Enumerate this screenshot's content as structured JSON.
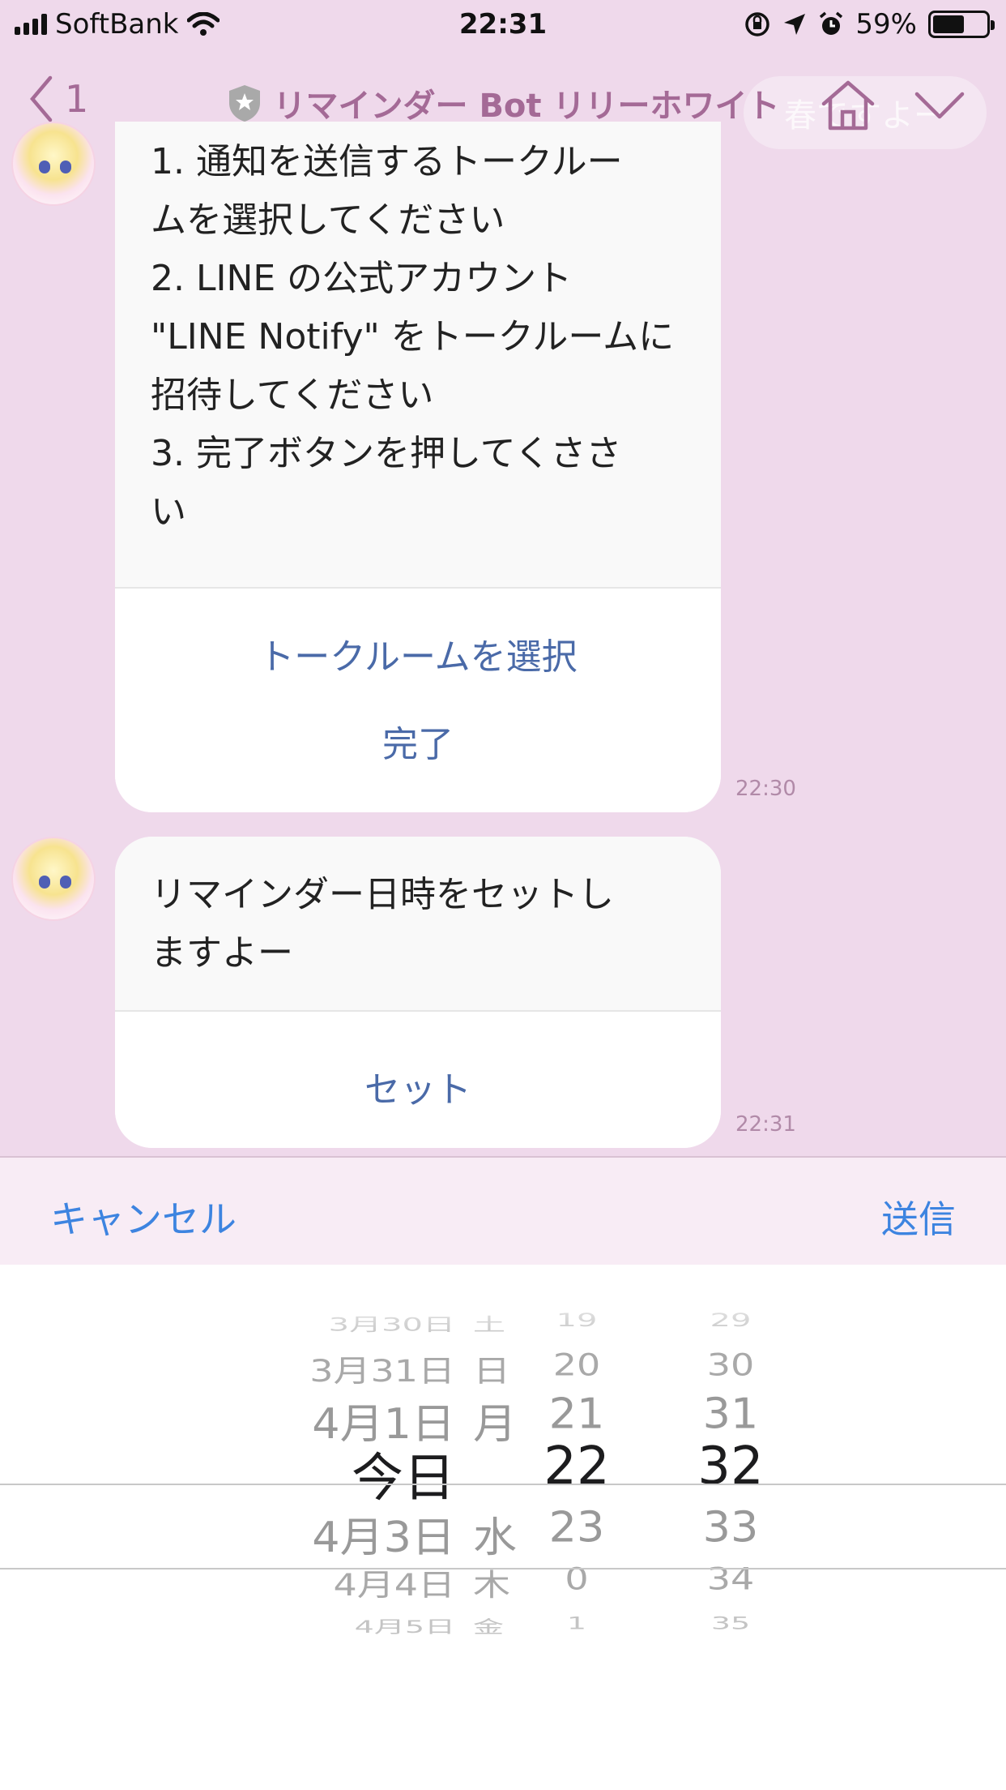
{
  "status_bar": {
    "carrier": "SoftBank",
    "time": "22:31",
    "battery": "59%",
    "battery_level": 0.59
  },
  "header": {
    "back_count": "1",
    "title": "リマインダー Bot リリーホワイト",
    "ghost_text": "春ですよー"
  },
  "messages": [
    {
      "lines": [
        "1. 通知を送信するトークルー",
        "ムを選択してください",
        "2. LINE の公式アカウント",
        "\"LINE Notify\" をトークルームに",
        "招待してください",
        "3. 完了ボタンを押してくささ",
        "い"
      ],
      "actions": [
        "トークルームを選択",
        "完了"
      ],
      "time": "22:30"
    },
    {
      "lines": [
        "リマインダー日時をセットし",
        "ますよー"
      ],
      "actions": [
        "セット"
      ],
      "time": "22:31"
    }
  ],
  "picker": {
    "cancel": "キャンセル",
    "send": "送信",
    "rows": [
      {
        "date": "3月30日",
        "dow": "土",
        "hour": "19",
        "minute": "29"
      },
      {
        "date": "3月31日",
        "dow": "日",
        "hour": "20",
        "minute": "30"
      },
      {
        "date": "4月1日",
        "dow": "月",
        "hour": "21",
        "minute": "31"
      },
      {
        "date": "今日",
        "dow": "",
        "hour": "22",
        "minute": "32"
      },
      {
        "date": "4月3日",
        "dow": "水",
        "hour": "23",
        "minute": "33"
      },
      {
        "date": "4月4日",
        "dow": "木",
        "hour": "0",
        "minute": "34"
      },
      {
        "date": "4月5日",
        "dow": "金",
        "hour": "1",
        "minute": "35"
      }
    ]
  },
  "colors": {
    "background": "#efd9eb",
    "accent": "#a46a96",
    "link": "#4a6aa8",
    "toolbar_button": "#3d84e0"
  }
}
